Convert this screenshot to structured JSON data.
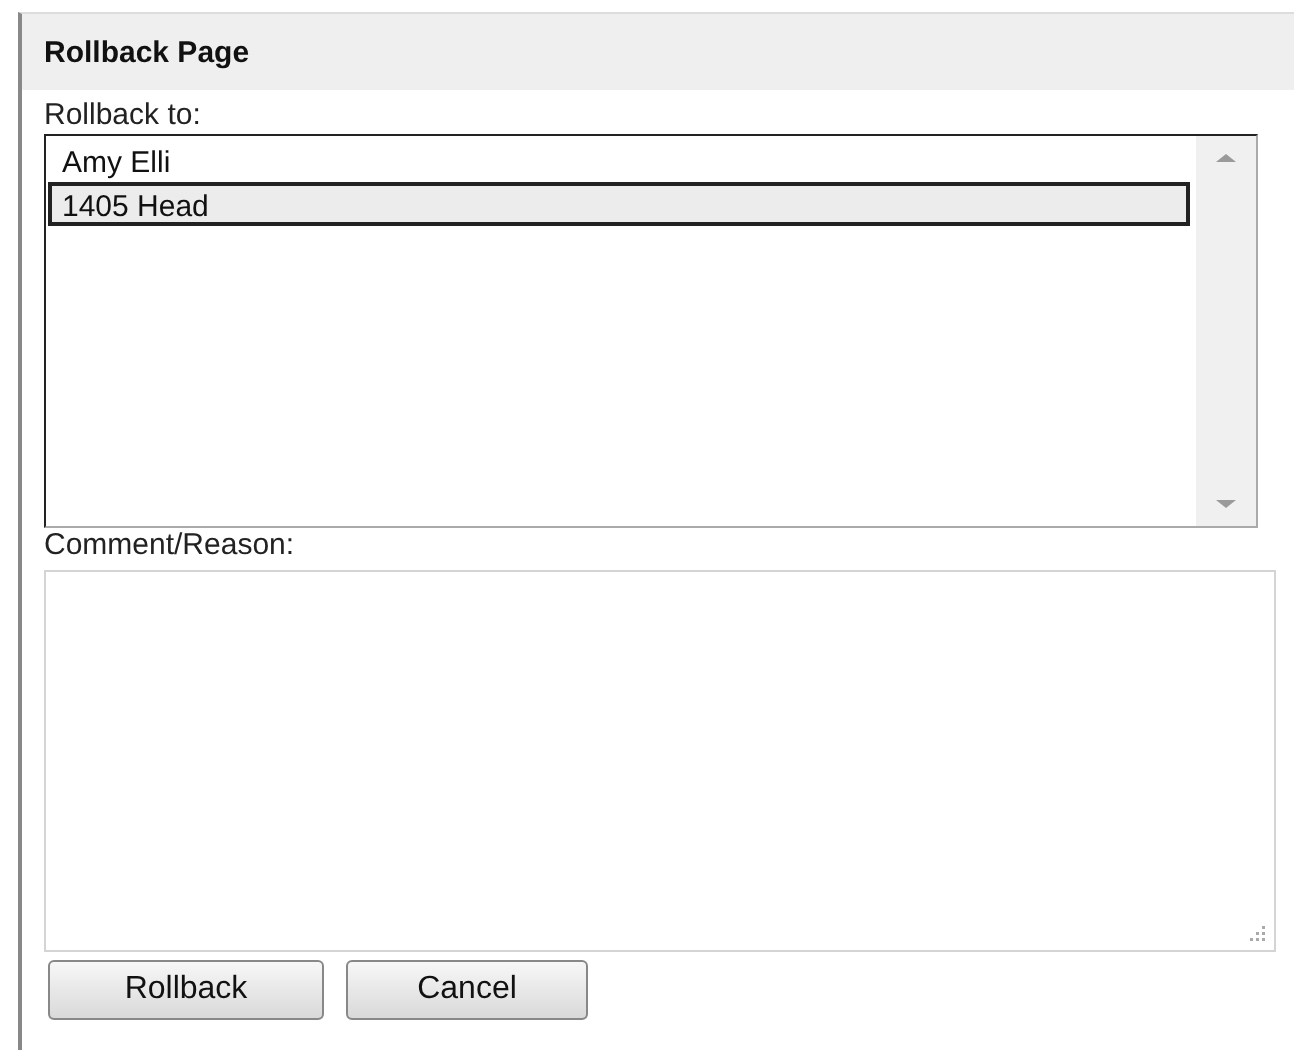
{
  "panel": {
    "title": "Rollback Page"
  },
  "rollback_to": {
    "label": "Rollback to:",
    "options": [
      {
        "label": "Amy Elli",
        "selected": false
      },
      {
        "label": "1405 Head",
        "selected": true
      }
    ]
  },
  "comment": {
    "label": "Comment/Reason:"
  },
  "buttons": [
    "Rollback",
    "Cancel"
  ]
}
